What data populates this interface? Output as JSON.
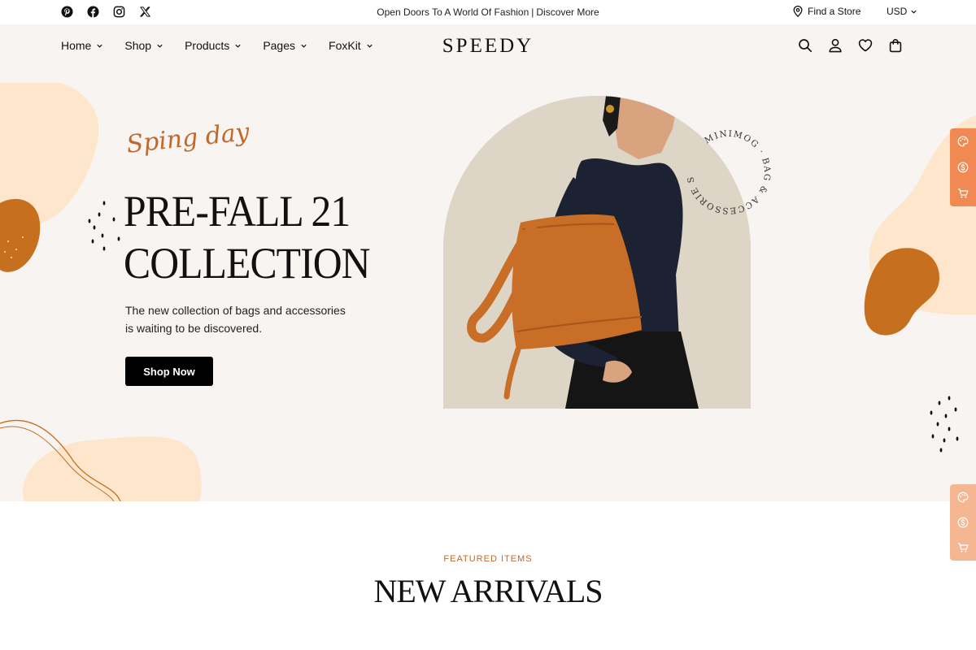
{
  "topbar": {
    "social": [
      "pinterest-icon",
      "facebook-icon",
      "instagram-icon",
      "x-icon"
    ],
    "announcement": "Open Doors To A World Of Fashion",
    "announcement_link": "Discover More",
    "find_store": "Find a Store",
    "currency": "USD"
  },
  "header": {
    "logo": "SPEEDY",
    "nav": [
      {
        "label": "Home"
      },
      {
        "label": "Shop"
      },
      {
        "label": "Products"
      },
      {
        "label": "Pages"
      },
      {
        "label": "FoxKit"
      }
    ],
    "icons": [
      "search-icon",
      "account-icon",
      "wishlist-icon",
      "cart-icon"
    ]
  },
  "hero": {
    "script": "Sping day",
    "headline_line1": "PRE-FALL 21",
    "headline_line2": "COLLECTION",
    "subtext_line1": "The new collection of bags and accessories",
    "subtext_line2": "is waiting to be discovered.",
    "button": "Shop Now",
    "badge_text": "MINIMOG · BAG & ACCESSORIE SHOP ·"
  },
  "featured": {
    "label": "FEATURED ITEMS",
    "title": "NEW ARRIVALS"
  },
  "colors": {
    "accent": "#c0692a",
    "blob_orange": "#c56f1f",
    "blob_peach": "#fde6cc",
    "hero_bg": "#f8f4f1",
    "side_panel": "#f08a52"
  }
}
